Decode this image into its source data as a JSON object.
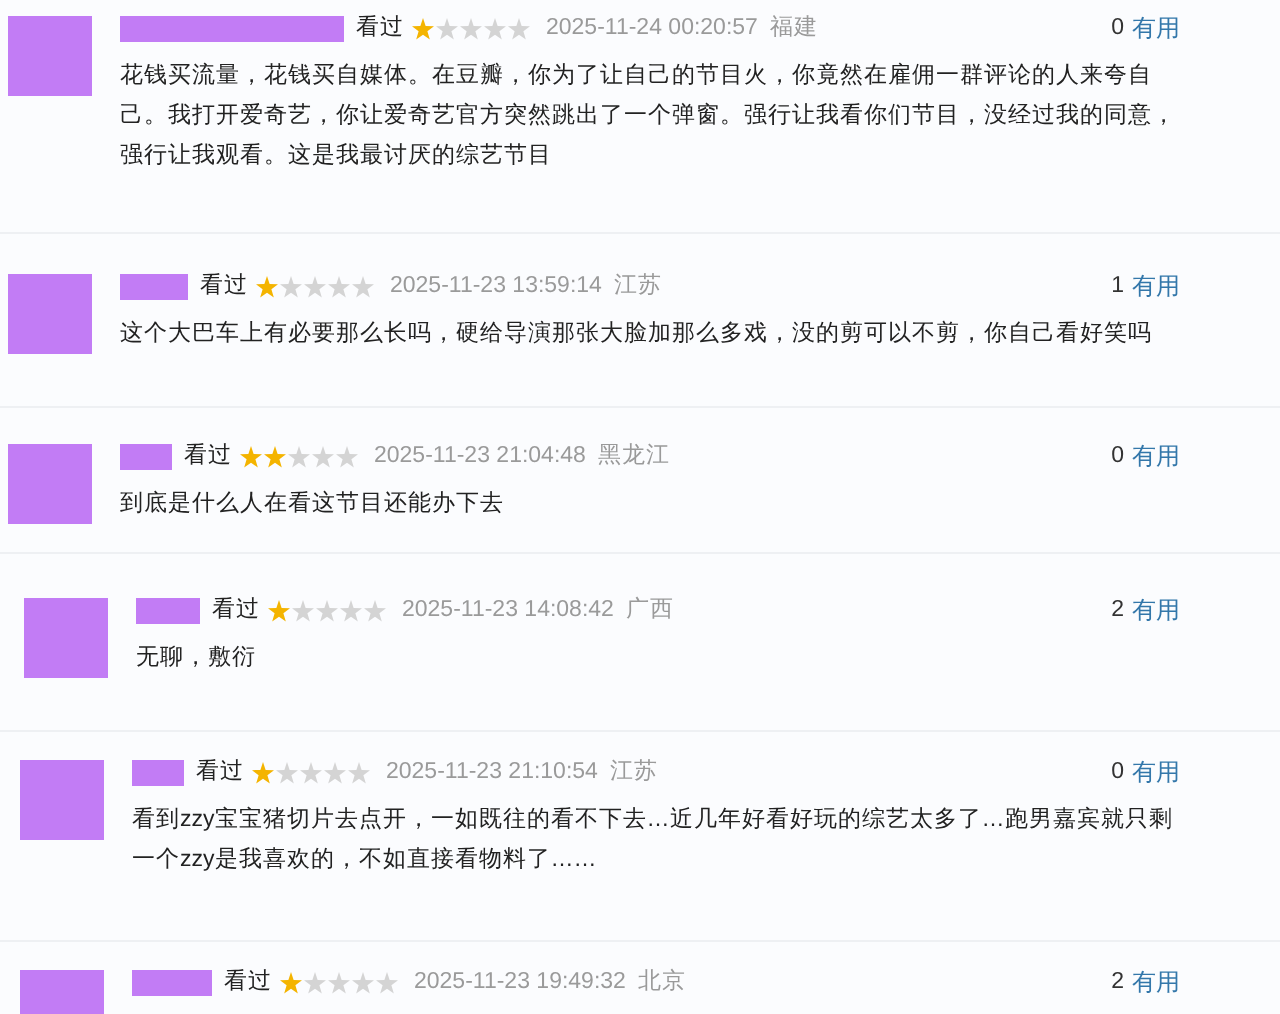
{
  "reviews": [
    {
      "status": "看过",
      "stars": 1,
      "time": "2025-11-24 00:20:57",
      "location": "福建",
      "useful_count": "0",
      "useful_label": "有用",
      "text": "花钱买流量，花钱买自媒体。在豆瓣，你为了让自己的节目火，你竟然在雇佣一群评论的人来夸自己。我打开爱奇艺，你让爱奇艺官方突然跳出了一个弹窗。强行让我看你们节目，没经过我的同意，强行让我观看。这是我最讨厌的综艺节目"
    },
    {
      "status": "看过",
      "stars": 1,
      "time": "2025-11-23 13:59:14",
      "location": "江苏",
      "useful_count": "1",
      "useful_label": "有用",
      "text": "这个大巴车上有必要那么长吗，硬给导演那张大脸加那么多戏，没的剪可以不剪，你自己看好笑吗"
    },
    {
      "status": "看过",
      "stars": 2,
      "time": "2025-11-23 21:04:48",
      "location": "黑龙江",
      "useful_count": "0",
      "useful_label": "有用",
      "text": "到底是什么人在看这节目还能办下去"
    },
    {
      "status": "看过",
      "stars": 1,
      "time": "2025-11-23 14:08:42",
      "location": "广西",
      "useful_count": "2",
      "useful_label": "有用",
      "text": "无聊，敷衍"
    },
    {
      "status": "看过",
      "stars": 1,
      "time": "2025-11-23 21:10:54",
      "location": "江苏",
      "useful_count": "0",
      "useful_label": "有用",
      "text": "看到zzy宝宝猪切片去点开，一如既往的看不下去…近几年好看好玩的综艺太多了…跑男嘉宾就只剩一个zzy是我喜欢的，不如直接看物料了……"
    },
    {
      "status": "看过",
      "stars": 1,
      "time": "2025-11-23 19:49:32",
      "location": "北京",
      "useful_count": "2",
      "useful_label": "有用"
    }
  ]
}
